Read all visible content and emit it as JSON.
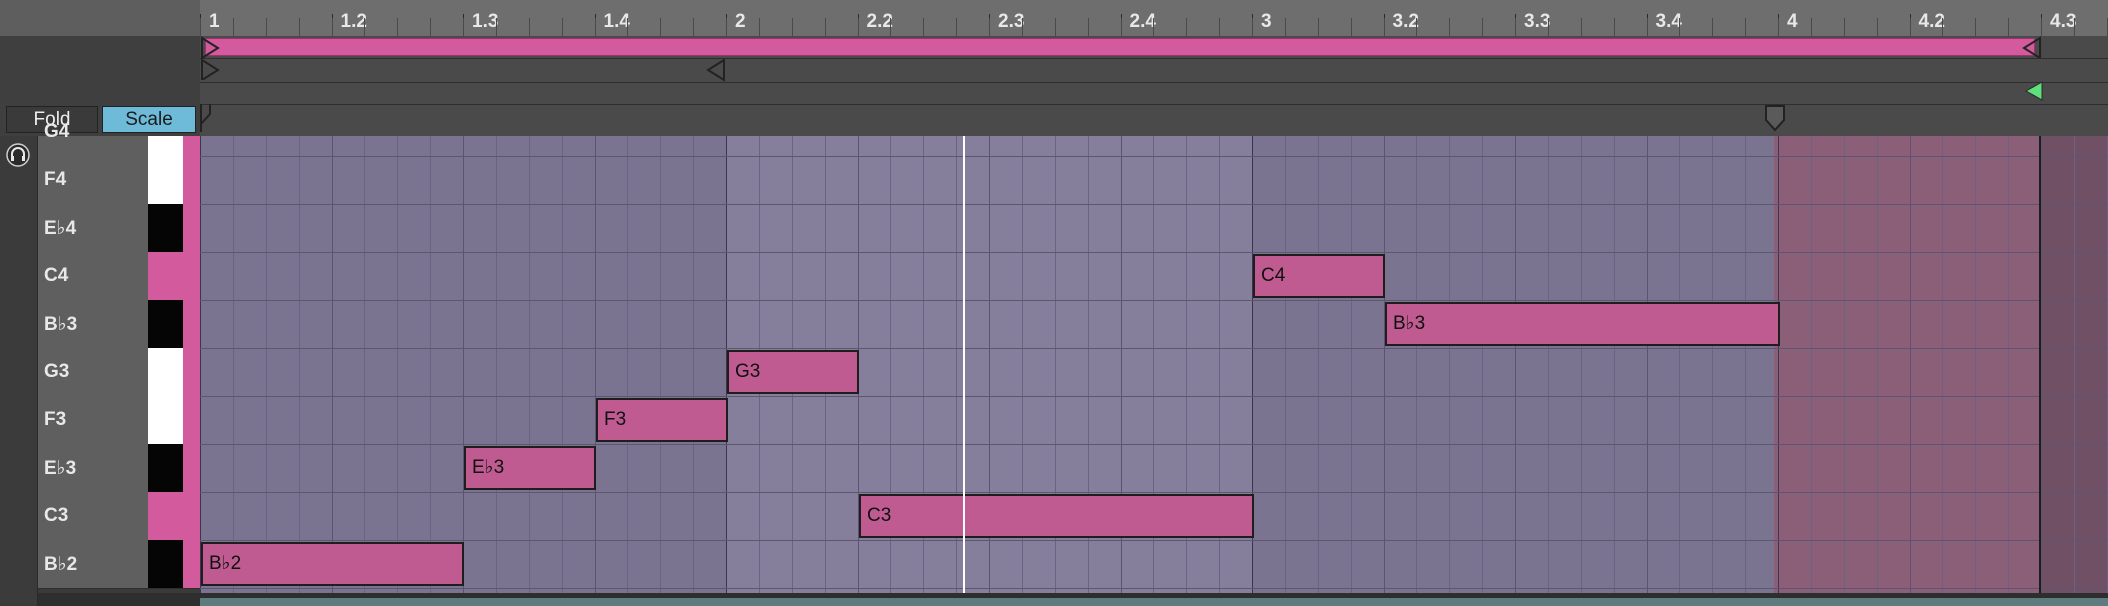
{
  "toolbar": {
    "fold_label": "Fold",
    "scale_label": "Scale"
  },
  "ruler": {
    "labels": [
      "1",
      "1.2",
      "1.3",
      "1.4",
      "2",
      "2.2",
      "2.3",
      "2.4",
      "3",
      "3.2",
      "3.3",
      "3.4",
      "4",
      "4.2",
      "4.3"
    ]
  },
  "keys": [
    {
      "name": "G4",
      "color": "white"
    },
    {
      "name": "F4",
      "color": "white"
    },
    {
      "name": "E♭4",
      "color": "black"
    },
    {
      "name": "C4",
      "color": "root"
    },
    {
      "name": "B♭3",
      "color": "black"
    },
    {
      "name": "G3",
      "color": "white"
    },
    {
      "name": "F3",
      "color": "white"
    },
    {
      "name": "E♭3",
      "color": "black"
    },
    {
      "name": "C3",
      "color": "root"
    },
    {
      "name": "B♭2",
      "color": "black"
    }
  ],
  "notes": [
    {
      "label": "B♭2",
      "pitch": "B♭2",
      "start": 1.0,
      "length": 0.5
    },
    {
      "label": "E♭3",
      "pitch": "E♭3",
      "start": 1.5,
      "length": 0.25
    },
    {
      "label": "F3",
      "pitch": "F3",
      "start": 1.75,
      "length": 0.25
    },
    {
      "label": "G3",
      "pitch": "G3",
      "start": 2.0,
      "length": 0.25
    },
    {
      "label": "C3",
      "pitch": "C3",
      "start": 2.25,
      "length": 0.75
    },
    {
      "label": "C4",
      "pitch": "C4",
      "start": 3.0,
      "length": 0.25
    },
    {
      "label": "B♭3",
      "pitch": "B♭3",
      "start": 3.25,
      "length": 0.75
    }
  ],
  "playhead_beat": 2.45,
  "colors": {
    "accent_pink": "#d35a9c",
    "note_fill": "#c05b92",
    "scale_button": "#6ebbd9",
    "grid_light": "#857f9c",
    "grid_dark": "#7a7490",
    "loop_outside": "#8c5f78"
  }
}
